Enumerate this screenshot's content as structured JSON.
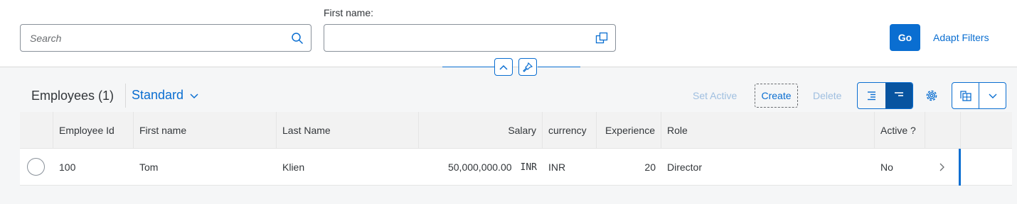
{
  "filter_bar": {
    "search_placeholder": "Search",
    "first_name_label": "First name:",
    "first_name_value": "",
    "go_label": "Go",
    "adapt_filters_label": "Adapt Filters"
  },
  "table_toolbar": {
    "title": "Employees (1)",
    "variant": "Standard",
    "actions": {
      "set_active": "Set Active",
      "create": "Create",
      "delete": "Delete"
    }
  },
  "table": {
    "columns": [
      "Employee Id",
      "First name",
      "Last Name",
      "Salary",
      "currency",
      "Experience",
      "Role",
      "Active ?"
    ],
    "rows": [
      {
        "employee_id": "100",
        "first_name": "Tom",
        "last_name": "Klien",
        "salary": "50,000,000.00",
        "salary_unit": "INR",
        "currency": "INR",
        "experience": "20",
        "role": "Director",
        "active": "No"
      }
    ]
  },
  "icons": {
    "search": "search-icon",
    "value_help": "value-help-icon",
    "collapse": "chevron-up-icon",
    "pin": "pin-icon",
    "variant_dropdown": "chevron-down-icon",
    "settings": "gear-icon",
    "export": "export-icon",
    "row_nav": "chevron-right-icon"
  },
  "colors": {
    "accent": "#0a6ed1",
    "accent_dark": "#0854a0",
    "text": "#32363a",
    "disabled_link": "#9fbfe0"
  }
}
